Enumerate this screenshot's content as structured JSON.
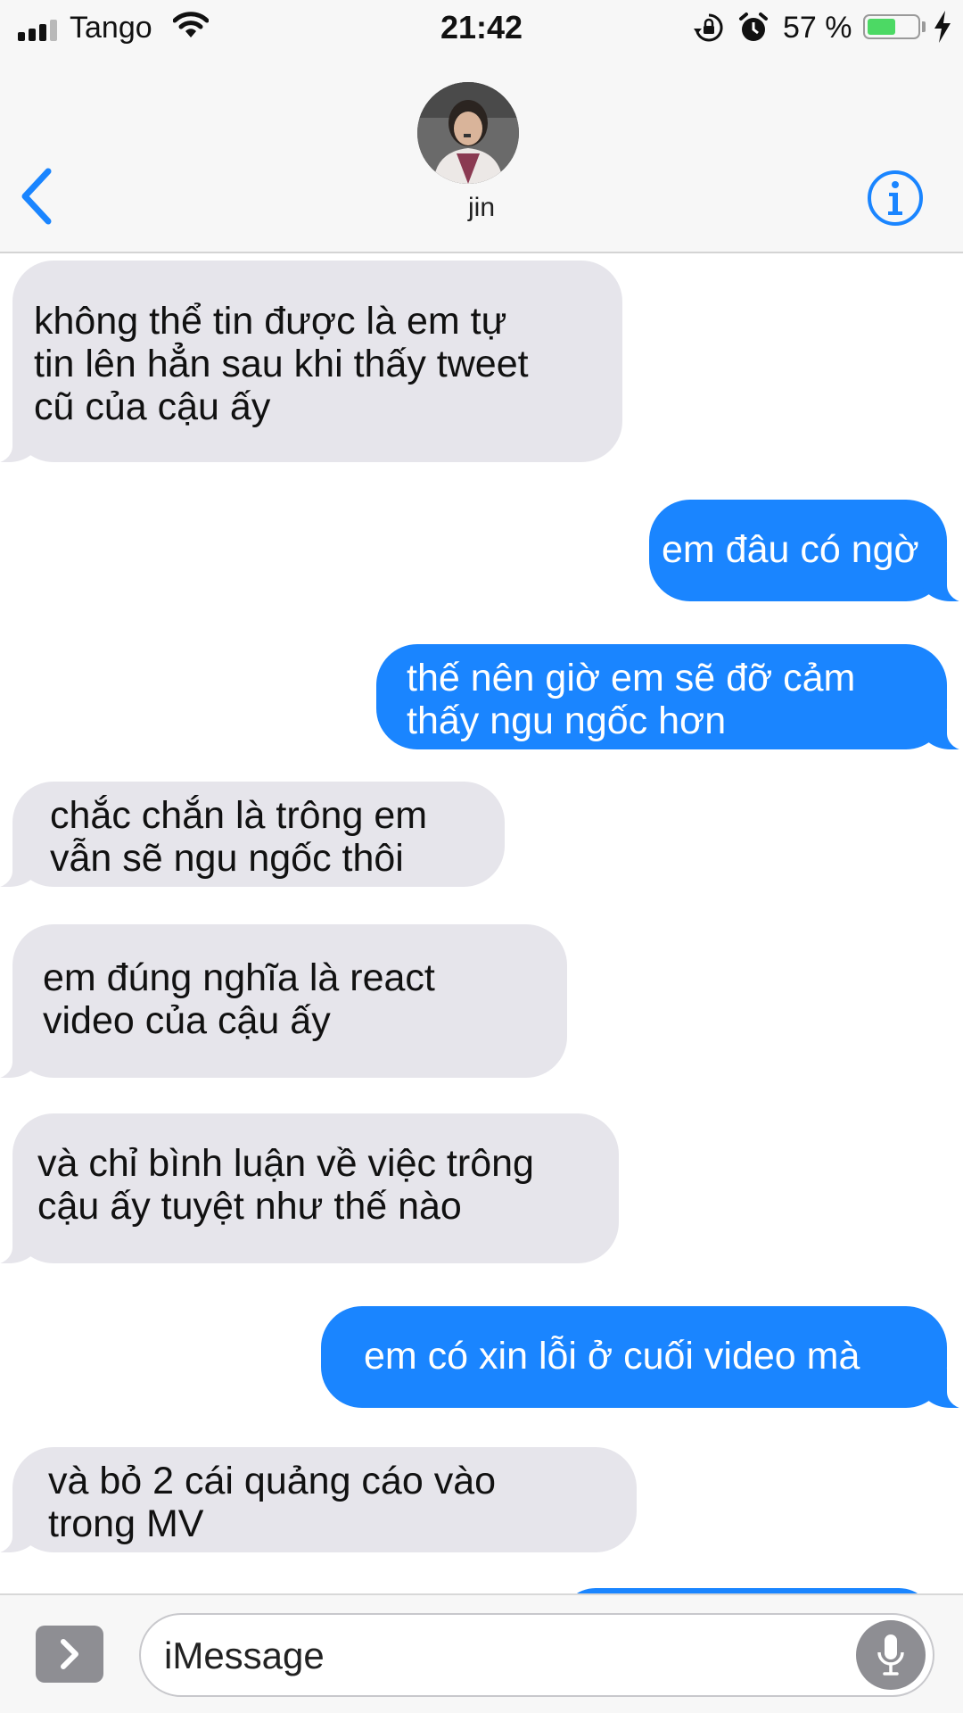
{
  "status_bar": {
    "carrier": "Tango",
    "signal_bars": 4,
    "signal_bars_filled": 3,
    "time": "21:42",
    "battery_text": "57 %",
    "battery_level": 0.57,
    "battery_color": "#4cd964",
    "icons": [
      "signal-icon",
      "wifi-icon",
      "rotation-lock-icon",
      "alarm-icon",
      "battery-icon",
      "charging-bolt-icon"
    ]
  },
  "header": {
    "contact_name": "jin",
    "back_icon": "chevron-left-icon",
    "info_icon": "info-icon",
    "accent_color": "#1a85ff"
  },
  "messages": [
    {
      "direction": "incoming",
      "text": "không thể tin được là em tự\ntin lên hẳn sau khi thấy tweet\ncũ của cậu ấy"
    },
    {
      "direction": "outgoing",
      "text": "em đâu có ngờ"
    },
    {
      "direction": "outgoing",
      "text": "thế nên giờ em sẽ đỡ cảm\nthấy ngu ngốc hơn"
    },
    {
      "direction": "incoming",
      "text": "chắc chắn là trông em\nvẫn sẽ ngu ngốc thôi"
    },
    {
      "direction": "incoming",
      "text": "em đúng nghĩa là react\nvideo của cậu ấy"
    },
    {
      "direction": "incoming",
      "text": "và chỉ bình luận về việc trông\ncậu ấy tuyệt như thế nào"
    },
    {
      "direction": "outgoing",
      "text": "em có xin lỗi ở cuối video mà"
    },
    {
      "direction": "incoming",
      "text": "và bỏ 2 cái quảng cáo vào\ntrong MV"
    },
    {
      "direction": "outgoing",
      "text": ""
    }
  ],
  "colors": {
    "incoming_bubble": "#e6e5eb",
    "outgoing_bubble": "#1a85ff"
  },
  "input_bar": {
    "placeholder": "iMessage",
    "apps_icon": "chevron-right-icon",
    "mic_icon": "microphone-icon"
  }
}
